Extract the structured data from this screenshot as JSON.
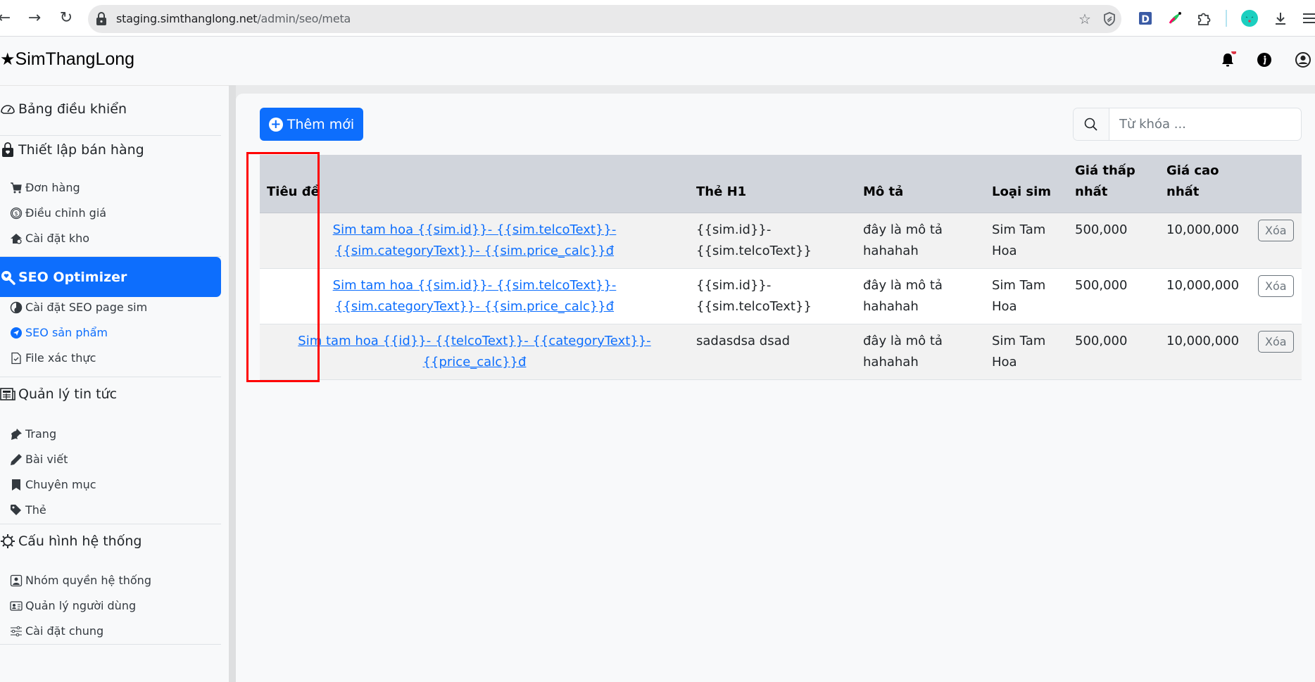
{
  "browser": {
    "url_host": "staging.simthanglong.net",
    "url_path": "/admin/seo/meta"
  },
  "header": {
    "brand": "SimThangLong",
    "notification_dot_color": "#dc3545"
  },
  "sidebar": {
    "sections": [
      {
        "label": "Bảng điều khiển",
        "icon": "dashboard-icon",
        "items": []
      },
      {
        "label": "Thiết lập bán hàng",
        "icon": "shopping-bag-icon",
        "items": [
          {
            "label": "Đơn hàng",
            "icon": "cart-icon"
          },
          {
            "label": "Điều chỉnh giá",
            "icon": "coin-icon"
          },
          {
            "label": "Cài đặt kho",
            "icon": "house-gear-icon"
          }
        ]
      },
      {
        "label": "SEO Optimizer",
        "icon": "search-heart-icon",
        "active": true,
        "items": [
          {
            "label": "Cài đặt SEO page sim",
            "icon": "pie-chart-icon"
          },
          {
            "label": "SEO sản phẩm",
            "icon": "send-icon",
            "active": true
          },
          {
            "label": "File xác thực",
            "icon": "file-check-icon"
          }
        ]
      },
      {
        "label": "Quản lý tin tức",
        "icon": "newspaper-icon",
        "items": [
          {
            "label": "Trang",
            "icon": "pin-icon"
          },
          {
            "label": "Bài viết",
            "icon": "pencil-icon"
          },
          {
            "label": "Chuyên mục",
            "icon": "bookmark-icon"
          },
          {
            "label": "Thẻ",
            "icon": "tags-icon"
          }
        ]
      },
      {
        "label": "Cấu hình hệ thống",
        "icon": "gear-icon",
        "items": [
          {
            "label": "Nhóm quyền hệ thống",
            "icon": "person-square-icon"
          },
          {
            "label": "Quản lý người dùng",
            "icon": "person-vcard-icon"
          },
          {
            "label": "Cài đặt chung",
            "icon": "sliders-icon"
          }
        ]
      }
    ]
  },
  "toolbar": {
    "add_label": "Thêm mới",
    "search_placeholder": "Từ khóa ..."
  },
  "table": {
    "columns": [
      "Tiêu đề",
      "Thẻ H1",
      "Mô tả",
      "Loại sim",
      "Giá thấp nhất",
      "Giá cao nhất",
      ""
    ],
    "rows": [
      {
        "title": "Sim tam hoa {{sim.id}}- {{sim.telcoText}}- {{sim.categoryText}}- {{sim.price_calc}}đ",
        "h1": "{{sim.id}}- {{sim.telcoText}}",
        "description": "đây là mô tả hahahah",
        "sim_type": "Sim Tam Hoa",
        "min_price": "500,000",
        "max_price": "10,000,000",
        "action": "Xóa"
      },
      {
        "title": "Sim tam hoa {{sim.id}}- {{sim.telcoText}}- {{sim.categoryText}}- {{sim.price_calc}}đ",
        "h1": "{{sim.id}}- {{sim.telcoText}}",
        "description": "đây là mô tả hahahah",
        "sim_type": "Sim Tam Hoa",
        "min_price": "500,000",
        "max_price": "10,000,000",
        "action": "Xóa"
      },
      {
        "title": "Sim tam hoa {{id}}- {{telcoText}}- {{categoryText}}- {{price_calc}}đ",
        "h1": "sadasdsa dsad",
        "description": "đây là mô tả hahahah",
        "sim_type": "Sim Tam Hoa",
        "min_price": "500,000",
        "max_price": "10,000,000",
        "action": "Xóa"
      }
    ]
  },
  "colors": {
    "accent": "#0d6efd",
    "highlight_box": "#ff0000",
    "table_header_bg": "#d1d5dc"
  }
}
